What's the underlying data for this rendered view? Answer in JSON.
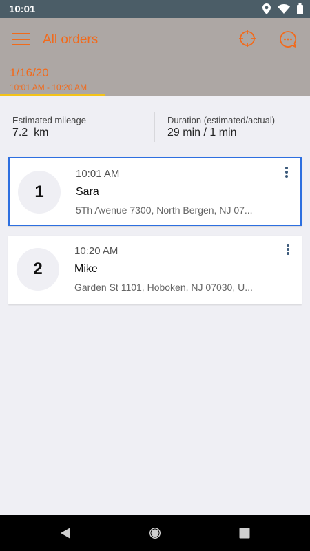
{
  "status_bar": {
    "time": "10:01",
    "icons": [
      "location-icon",
      "wifi-icon",
      "battery-icon"
    ]
  },
  "app_bar": {
    "title": "All orders",
    "menu_icon": "hamburger-menu-icon",
    "target_icon": "crosshair-icon",
    "chat_icon": "chat-bubble-icon",
    "accent_color": "#f26a1b",
    "background_color": "#ada7a4"
  },
  "date_tab": {
    "date": "1/16/20",
    "range": "10:01 AM - 10:20 AM",
    "underline_color": "#f3c319"
  },
  "stats": {
    "mileage_label": "Estimated mileage",
    "mileage_value": "7.2  km",
    "duration_label": "Duration (estimated/actual)",
    "duration_value": "29 min / 1 min"
  },
  "orders": [
    {
      "number": "1",
      "time": "10:01 AM",
      "name": "Sara",
      "address": "5Th Avenue 7300, North Bergen, NJ 07...",
      "selected": true
    },
    {
      "number": "2",
      "time": "10:20 AM",
      "name": "Mike",
      "address": "Garden St 1101, Hoboken, NJ 07030, U...",
      "selected": false
    }
  ],
  "nav_bar": {
    "back_icon": "back-triangle-icon",
    "home_icon": "home-circle-icon",
    "recents_icon": "recents-square-icon"
  }
}
